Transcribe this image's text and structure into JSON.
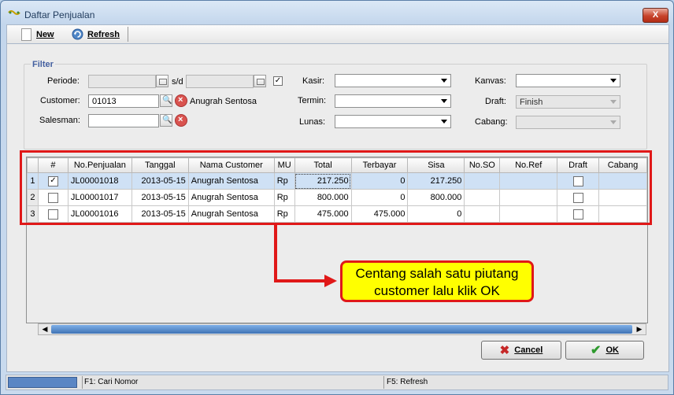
{
  "window": {
    "title": "Daftar Penjualan",
    "close_glyph": "X"
  },
  "toolbar": {
    "new_label": "New",
    "refresh_label": "Refresh"
  },
  "filter": {
    "legend": "Filter",
    "periode_label": "Periode:",
    "sd_label": "s/d",
    "customer_label": "Customer:",
    "customer_value": "01013",
    "customer_name": "Anugrah Sentosa",
    "salesman_label": "Salesman:",
    "kasir_label": "Kasir:",
    "termin_label": "Termin:",
    "lunas_label": "Lunas:",
    "kanvas_label": "Kanvas:",
    "draft_label": "Draft:",
    "draft_value": "Finish",
    "cabang_label": "Cabang:"
  },
  "grid": {
    "columns": [
      "#",
      "No.Penjualan",
      "Tanggal",
      "Nama Customer",
      "MU",
      "Total",
      "Terbayar",
      "Sisa",
      "No.SO",
      "No.Ref",
      "Draft",
      "Cabang"
    ],
    "rows": [
      {
        "n": "1",
        "checked": true,
        "no": "JL00001018",
        "tanggal": "2013-05-15",
        "customer": "Anugrah Sentosa",
        "mu": "Rp",
        "total": "217.250",
        "terbayar": "0",
        "sisa": "217.250"
      },
      {
        "n": "2",
        "checked": false,
        "no": "JL00001017",
        "tanggal": "2013-05-15",
        "customer": "Anugrah Sentosa",
        "mu": "Rp",
        "total": "800.000",
        "terbayar": "0",
        "sisa": "800.000"
      },
      {
        "n": "3",
        "checked": false,
        "no": "JL00001016",
        "tanggal": "2013-05-15",
        "customer": "Anugrah Sentosa",
        "mu": "Rp",
        "total": "475.000",
        "terbayar": "475.000",
        "sisa": "0"
      }
    ]
  },
  "callout": {
    "line1": "Centang salah satu piutang",
    "line2": "customer lalu klik OK"
  },
  "buttons": {
    "cancel_label": "Cancel",
    "ok_label": "OK"
  },
  "statusbar": {
    "f1": "F1: Cari Nomor",
    "f5": "F5: Refresh"
  },
  "colors": {
    "annotation_red": "#e01818",
    "callout_yellow": "#ffff00",
    "selected_row": "#cfe1f5"
  }
}
